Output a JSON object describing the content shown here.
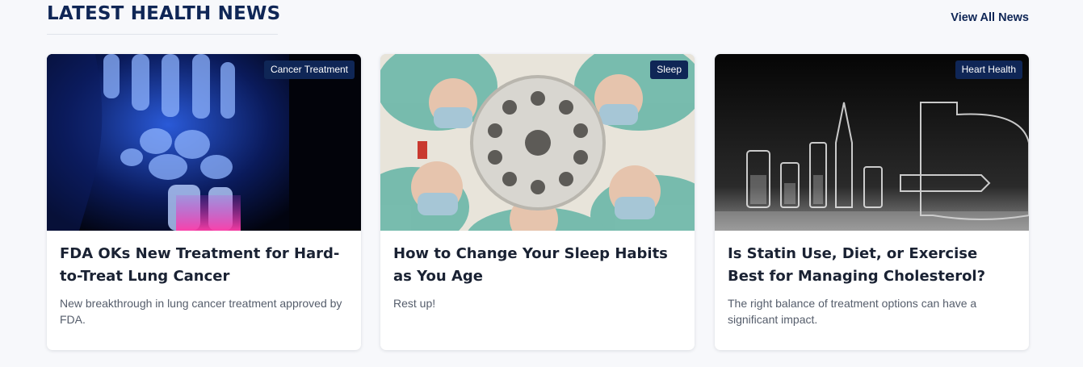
{
  "section": {
    "title": "LATEST HEALTH NEWS",
    "view_all_label": "View All News"
  },
  "cards": [
    {
      "category": "Cancer Treatment",
      "title": "FDA OKs New Treatment for Hard-to-Treat Lung Cancer",
      "description": "New breakthrough in lung cancer treatment approved by FDA.",
      "image": "hand-xray-image"
    },
    {
      "category": "Sleep",
      "title": "How to Change Your Sleep Habits as You Age",
      "description": "Rest up!",
      "image": "surgeons-overhead-image"
    },
    {
      "category": "Heart Health",
      "title": "Is Statin Use, Diet, or Exercise Best for Managing Cholesterol?",
      "description": "The right balance of treatment options can have a significant impact.",
      "image": "medicine-vials-image"
    }
  ],
  "colors": {
    "brand_navy": "#0f2656",
    "page_background": "#f7f8fb",
    "card_background": "#ffffff"
  }
}
